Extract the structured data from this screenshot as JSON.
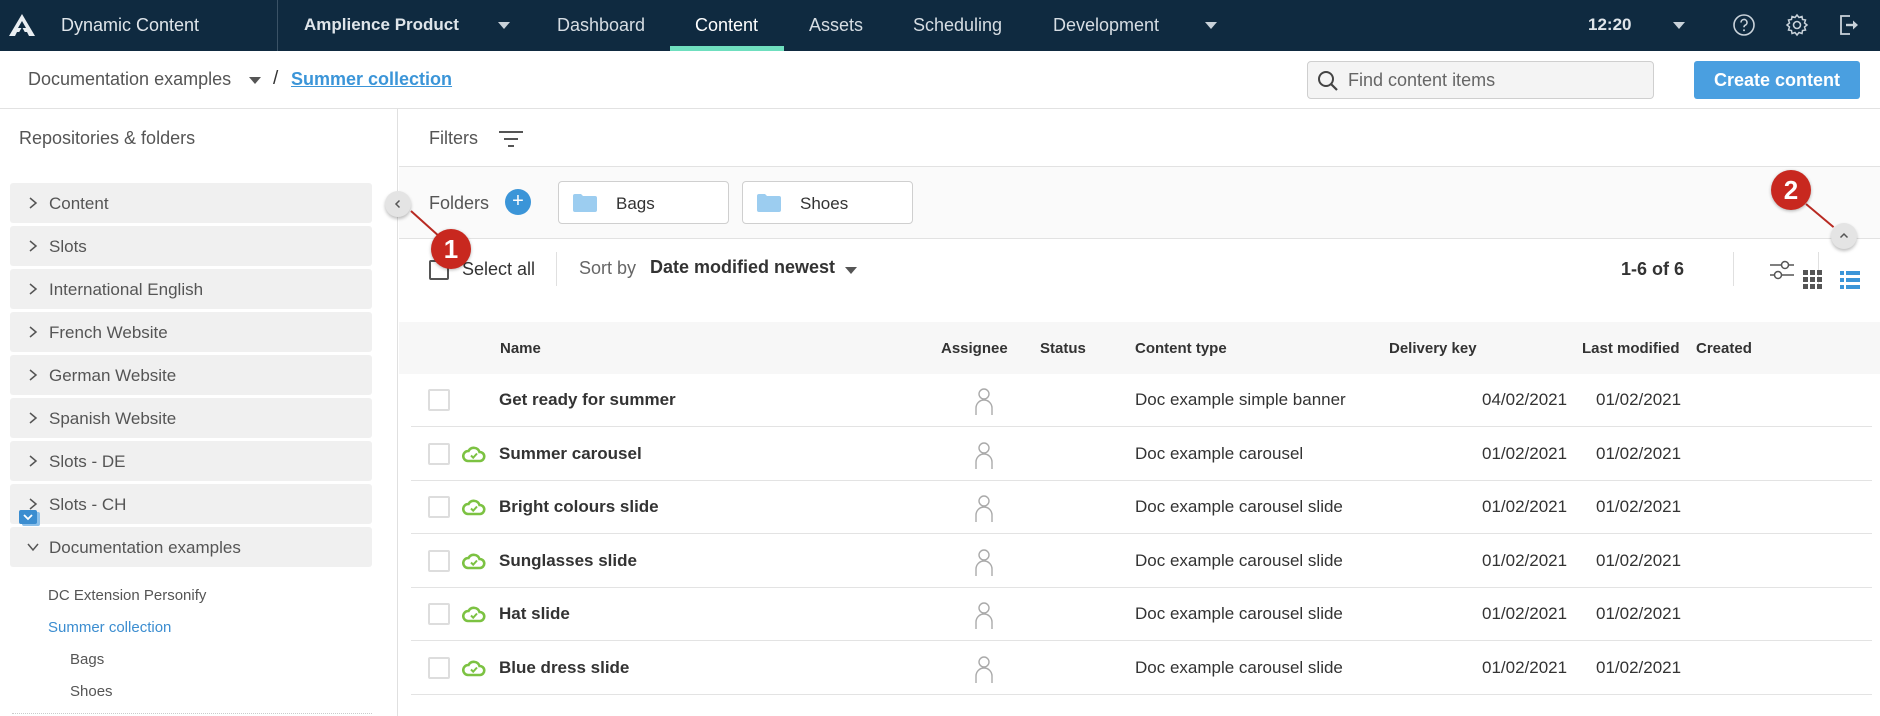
{
  "topbar": {
    "app_title": "Dynamic Content",
    "hub_name": "Amplience Product",
    "nav_tabs": [
      {
        "label": "Dashboard",
        "active": false
      },
      {
        "label": "Content",
        "active": true
      },
      {
        "label": "Assets",
        "active": false
      },
      {
        "label": "Scheduling",
        "active": false
      },
      {
        "label": "Development",
        "active": false
      }
    ],
    "clock": "12:20",
    "icons": [
      "help-icon",
      "settings-icon",
      "logout-icon"
    ],
    "active_tab_color": "#6fdfbf",
    "bg_color": "#0f2a40"
  },
  "subheader": {
    "breadcrumb_repo": "Documentation examples",
    "breadcrumb_separator": "/",
    "breadcrumb_current": "Summer collection",
    "search_placeholder": "Find content items",
    "create_button": "Create content",
    "accent_color": "#4a9fe0"
  },
  "sidebar": {
    "title": "Repositories & folders",
    "repositories": [
      {
        "label": "Content",
        "expanded": false
      },
      {
        "label": "Slots",
        "expanded": false
      },
      {
        "label": "International English",
        "expanded": false
      },
      {
        "label": "French Website",
        "expanded": false
      },
      {
        "label": "German Website",
        "expanded": false
      },
      {
        "label": "Spanish Website",
        "expanded": false
      },
      {
        "label": "Slots - DE",
        "expanded": false
      },
      {
        "label": "Slots - CH",
        "expanded": false
      },
      {
        "label": "Documentation examples",
        "expanded": true
      }
    ],
    "folders": [
      {
        "label": "DC Extension Personify",
        "level": 1,
        "active": false
      },
      {
        "label": "Summer collection",
        "level": 1,
        "active": true
      },
      {
        "label": "Bags",
        "level": 2,
        "active": false
      },
      {
        "label": "Shoes",
        "level": 2,
        "active": false
      }
    ]
  },
  "main": {
    "filters_label": "Filters",
    "folders_label": "Folders",
    "folder_chips": [
      "Bags",
      "Shoes"
    ],
    "select_all_label": "Select all",
    "sort_by_label": "Sort by",
    "sort_value": "Date modified newest",
    "pager": "1-6 of 6",
    "annotations": [
      "1",
      "2"
    ],
    "table": {
      "columns": [
        "Name",
        "Assignee",
        "Status",
        "Content type",
        "Delivery key",
        "Last modified",
        "Created"
      ],
      "rows": [
        {
          "name": "Get ready for summer",
          "published": false,
          "assignee": "",
          "status": "",
          "content_type": "Doc example simple banner",
          "delivery_key": "",
          "last_modified": "04/02/2021",
          "created": "01/02/2021"
        },
        {
          "name": "Summer carousel",
          "published": true,
          "assignee": "",
          "status": "",
          "content_type": "Doc example carousel",
          "delivery_key": "",
          "last_modified": "01/02/2021",
          "created": "01/02/2021"
        },
        {
          "name": "Bright colours slide",
          "published": true,
          "assignee": "",
          "status": "",
          "content_type": "Doc example carousel slide",
          "delivery_key": "",
          "last_modified": "01/02/2021",
          "created": "01/02/2021"
        },
        {
          "name": "Sunglasses slide",
          "published": true,
          "assignee": "",
          "status": "",
          "content_type": "Doc example carousel slide",
          "delivery_key": "",
          "last_modified": "01/02/2021",
          "created": "01/02/2021"
        },
        {
          "name": "Hat slide",
          "published": true,
          "assignee": "",
          "status": "",
          "content_type": "Doc example carousel slide",
          "delivery_key": "",
          "last_modified": "01/02/2021",
          "created": "01/02/2021"
        },
        {
          "name": "Blue dress slide",
          "published": true,
          "assignee": "",
          "status": "",
          "content_type": "Doc example carousel slide",
          "delivery_key": "",
          "last_modified": "01/02/2021",
          "created": "01/02/2021"
        }
      ]
    },
    "published_color": "#7cc242",
    "annotation_color": "#c8281f"
  }
}
